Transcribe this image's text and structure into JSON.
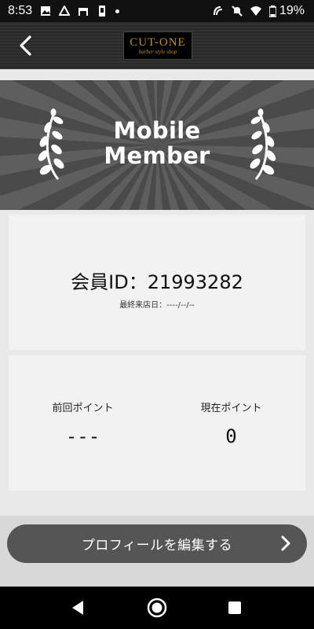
{
  "status_bar": {
    "time": "8:53",
    "battery": "19%"
  },
  "header": {
    "logo_text": "CUT-ONE",
    "logo_sub": "barber style shop"
  },
  "banner": {
    "title_line1": "Mobile",
    "title_line2": "Member"
  },
  "member": {
    "id_text": "会員ID：21993282",
    "last_visit": "最終来店日：----/--/--"
  },
  "points": {
    "previous_label": "前回ポイント",
    "previous_value": "---",
    "current_label": "現在ポイント",
    "current_value": "0"
  },
  "actions": {
    "edit_profile_label": "プロフィールを編集する"
  },
  "icons": {
    "back": "back-arrow-icon",
    "laurel": "laurel-icon",
    "chevron": "chevron-right-icon"
  }
}
